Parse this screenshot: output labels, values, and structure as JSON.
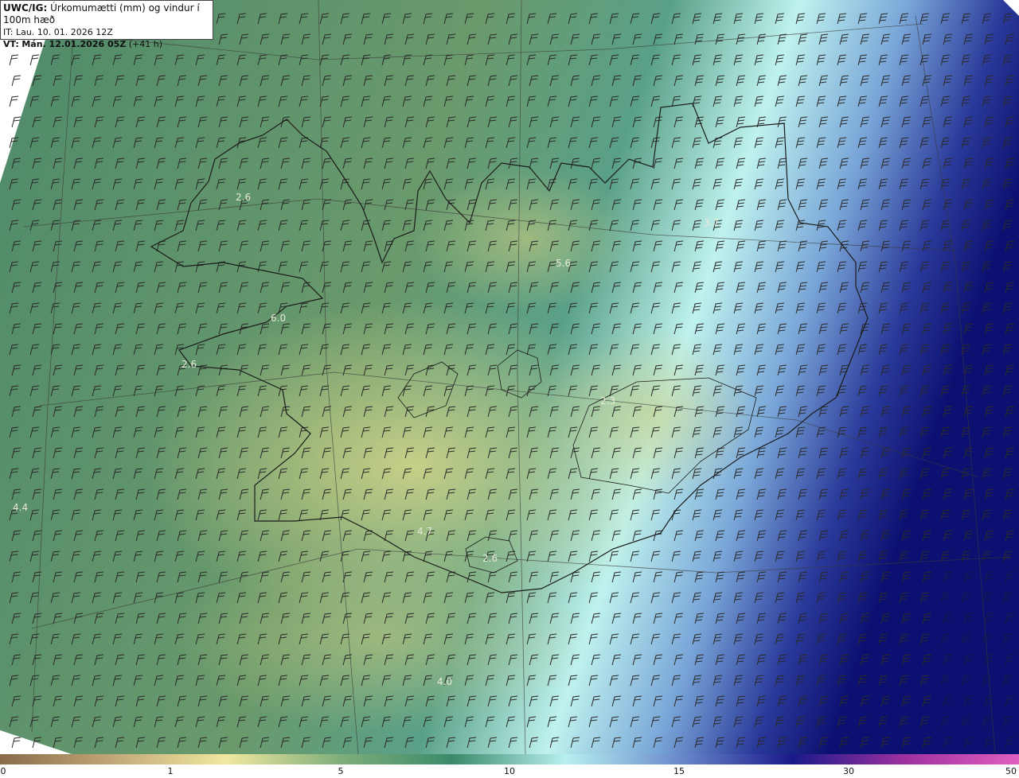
{
  "header": {
    "model": "UWC/IG:",
    "title": "Úrkomumætti (mm) og vindur í 100m hæð",
    "it_line": "IT: Lau. 10. 01. 2026 12Z",
    "vt_prefix": "VT:",
    "vt_time": "Mán. 12.01.2026 05Z",
    "vt_offset": "(+41 h)"
  },
  "map_labels": [
    {
      "text": "2.6"
    },
    {
      "text": "3.7"
    },
    {
      "text": "5.6"
    },
    {
      "text": "6.0"
    },
    {
      "text": "2.6"
    },
    {
      "text": "2.3"
    },
    {
      "text": "4.4"
    },
    {
      "text": "4.7"
    },
    {
      "text": "2.6"
    },
    {
      "text": "4.0"
    }
  ],
  "colorbar": {
    "ticks": [
      "0",
      "1",
      "5",
      "10",
      "15",
      "30",
      "50"
    ],
    "colors": [
      "#8a6a4a",
      "#c2a878",
      "#f0e8a0",
      "#7fae7a",
      "#3a8a6a",
      "#b8f0f0",
      "#6a8acc",
      "#1a1a8a",
      "#a030a0",
      "#e060c0"
    ]
  }
}
